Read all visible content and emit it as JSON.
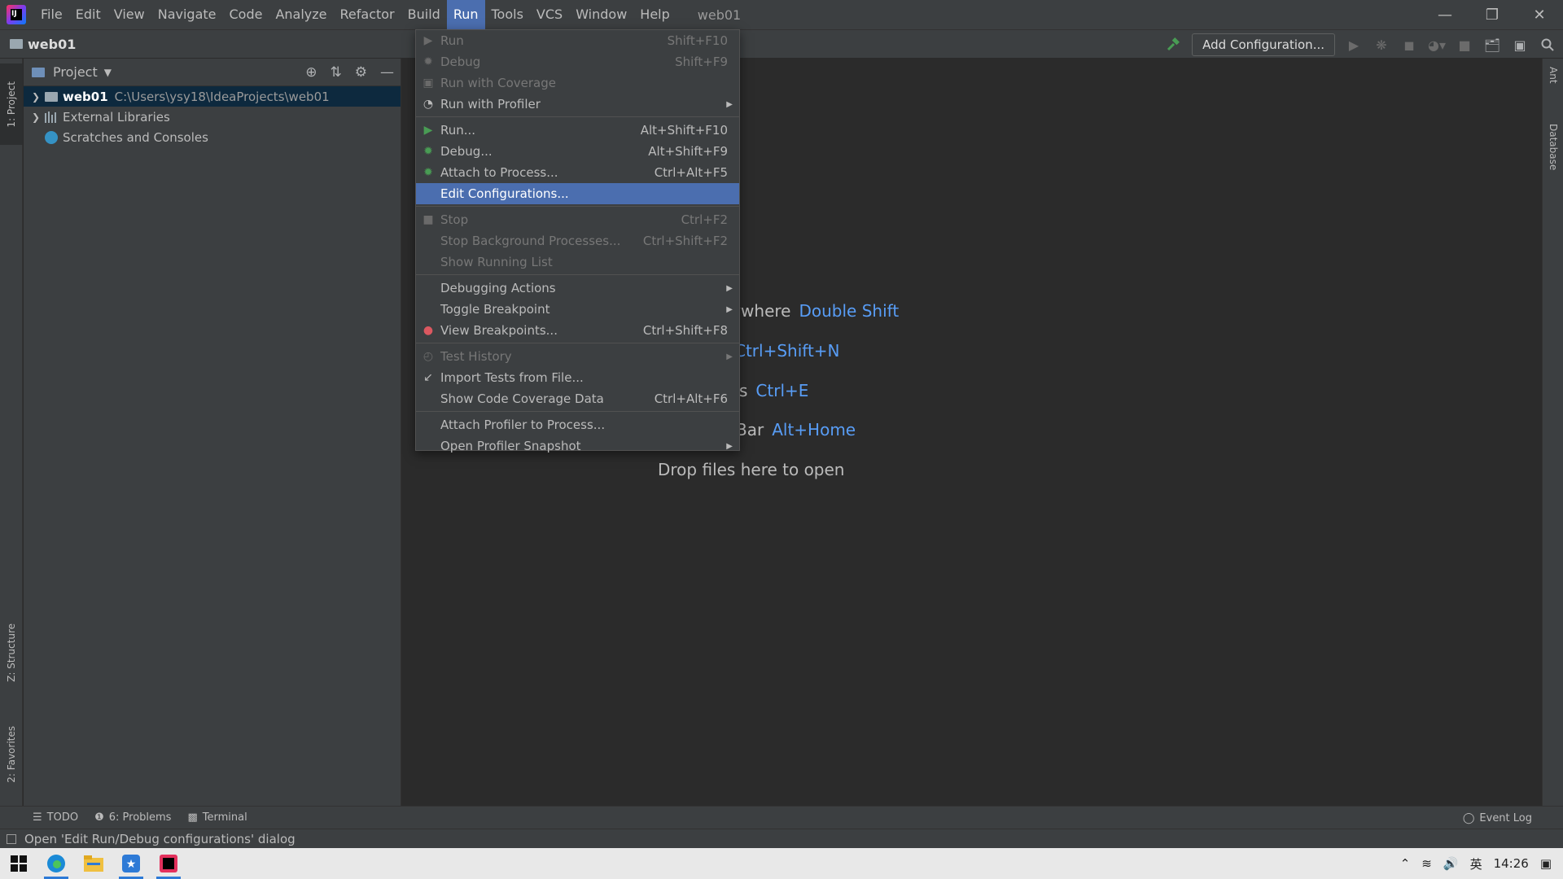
{
  "menubar": {
    "items": [
      "File",
      "Edit",
      "View",
      "Navigate",
      "Code",
      "Analyze",
      "Refactor",
      "Build",
      "Run",
      "Tools",
      "VCS",
      "Window",
      "Help"
    ],
    "active": "Run",
    "window_title": "web01"
  },
  "navbar": {
    "project": "web01",
    "add_configuration": "Add Configuration..."
  },
  "left_stripe": {
    "project_tab": "1: Project",
    "structure_tab": "Z: Structure",
    "favorites_tab": "2: Favorites"
  },
  "right_stripe": {
    "ant_tab": "Ant",
    "database_tab": "Database"
  },
  "project_panel": {
    "title": "Project",
    "tree": [
      {
        "name": "web01",
        "path": "C:\\Users\\ysy18\\IdeaProjects\\web01"
      },
      {
        "name": "External Libraries"
      },
      {
        "name": "Scratches and Consoles"
      }
    ]
  },
  "editor_hints": {
    "search_everywhere": {
      "text": "rywhere",
      "key": "Double Shift"
    },
    "go_to_file": {
      "text": "",
      "key": "Ctrl+Shift+N"
    },
    "recent_files": {
      "text": "s",
      "key": "Ctrl+E"
    },
    "nav_bar": {
      "text": "Bar",
      "key": "Alt+Home"
    },
    "drop": "Drop files here to open"
  },
  "run_menu": {
    "groups": [
      [
        {
          "label": "Run",
          "shortcut": "Shift+F10",
          "disabled": true,
          "icon": "run-icon"
        },
        {
          "label": "Debug",
          "shortcut": "Shift+F9",
          "disabled": true,
          "icon": "debug-icon"
        },
        {
          "label": "Run with Coverage",
          "shortcut": "",
          "disabled": true,
          "icon": "coverage-icon"
        },
        {
          "label": "Run with Profiler",
          "shortcut": "",
          "disabled": false,
          "icon": "profiler-icon",
          "submenu": true
        }
      ],
      [
        {
          "label": "Run...",
          "shortcut": "Alt+Shift+F10",
          "disabled": false,
          "icon": "run-icon"
        },
        {
          "label": "Debug...",
          "shortcut": "Alt+Shift+F9",
          "disabled": false,
          "icon": "debug-icon"
        },
        {
          "label": "Attach to Process...",
          "shortcut": "Ctrl+Alt+F5",
          "disabled": false,
          "icon": "attach-icon"
        },
        {
          "label": "Edit Configurations...",
          "shortcut": "",
          "disabled": false,
          "highlight": true
        }
      ],
      [
        {
          "label": "Stop",
          "shortcut": "Ctrl+F2",
          "disabled": true,
          "icon": "stop-icon"
        },
        {
          "label": "Stop Background Processes...",
          "shortcut": "Ctrl+Shift+F2",
          "disabled": true
        },
        {
          "label": "Show Running List",
          "shortcut": "",
          "disabled": true
        }
      ],
      [
        {
          "label": "Debugging Actions",
          "shortcut": "",
          "disabled": false,
          "submenu": true
        },
        {
          "label": "Toggle Breakpoint",
          "shortcut": "",
          "disabled": false,
          "submenu": true
        },
        {
          "label": "View Breakpoints...",
          "shortcut": "Ctrl+Shift+F8",
          "disabled": false,
          "icon": "breakpoints-icon"
        }
      ],
      [
        {
          "label": "Test History",
          "shortcut": "",
          "disabled": true,
          "icon": "history-icon",
          "submenu": true
        },
        {
          "label": "Import Tests from File...",
          "shortcut": "",
          "disabled": false,
          "icon": "import-icon"
        },
        {
          "label": "Show Code Coverage Data",
          "shortcut": "Ctrl+Alt+F6",
          "disabled": false
        }
      ],
      [
        {
          "label": "Attach Profiler to Process...",
          "shortcut": "",
          "disabled": false
        },
        {
          "label": "Open Profiler Snapshot",
          "shortcut": "",
          "disabled": false,
          "submenu": true
        }
      ]
    ]
  },
  "bottom_bar": {
    "todo": "TODO",
    "problems": "6: Problems",
    "terminal": "Terminal",
    "event_log": "Event Log"
  },
  "status": {
    "message": "Open 'Edit Run/Debug configurations' dialog"
  },
  "taskbar": {
    "ime": "英",
    "time": "14:26"
  },
  "colors": {
    "accent": "#4b6eaf",
    "key_hint": "#589df6",
    "panel_bg": "#3c3f41",
    "editor_bg": "#2b2b2b"
  }
}
